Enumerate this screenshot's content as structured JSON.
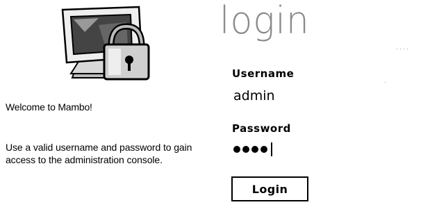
{
  "left_panel": {
    "illustration_icon": "monitor-with-padlock",
    "welcome_text": "Welcome to Mambo!",
    "help_text": "Use a valid username and password to gain access to the administration console."
  },
  "login_form": {
    "title": "login",
    "username_label": "Username",
    "username_value": "admin",
    "password_label": "Password",
    "password_mask": "●●●●",
    "submit_label": "Login"
  }
}
